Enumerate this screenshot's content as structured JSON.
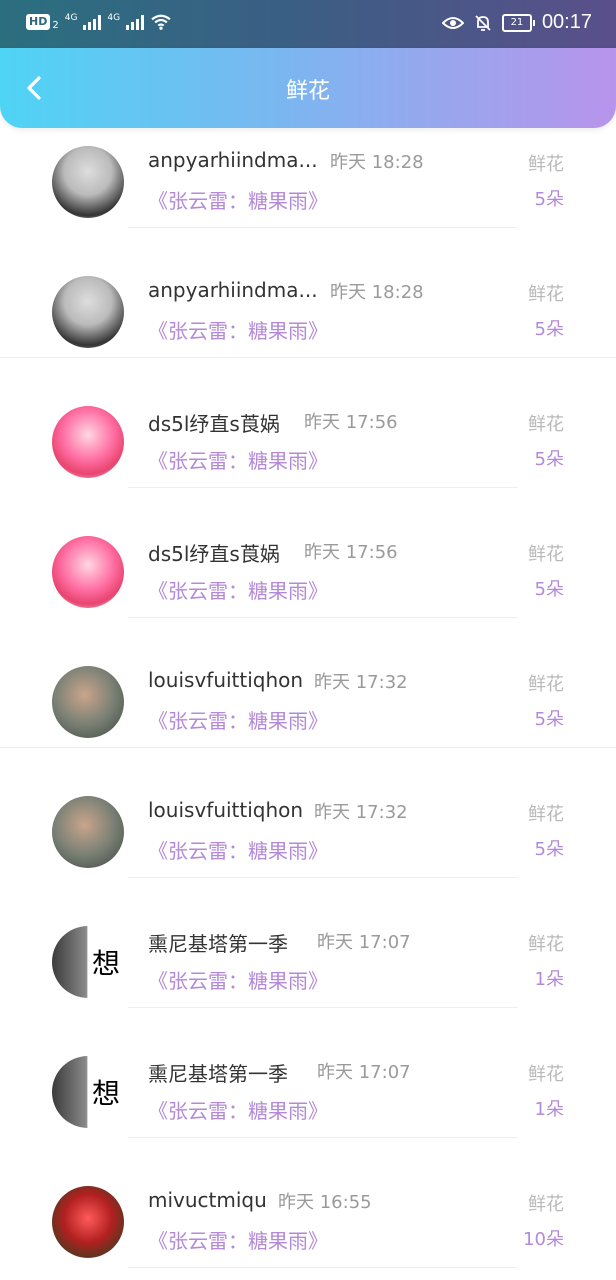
{
  "status_bar": {
    "hd_label": "HD",
    "hd_sub": "2",
    "net1": "4G",
    "net2": "4G",
    "battery": "21",
    "time": "00:17"
  },
  "header": {
    "title": "鲜花"
  },
  "records": [
    {
      "name": "anpyarhiindma...",
      "time": "昨天 18:28",
      "work": "《张云雷：糖果雨》",
      "gift_label": "鲜花",
      "gift_count": "5朵",
      "avatar": "police"
    },
    {
      "name": "anpyarhiindma...",
      "time": "昨天 18:28",
      "work": "《张云雷：糖果雨》",
      "gift_label": "鲜花",
      "gift_count": "5朵",
      "avatar": "police"
    },
    {
      "name": "ds5l纾直s莨娲",
      "time": "昨天 17:56",
      "work": "《张云雷：糖果雨》",
      "gift_label": "鲜花",
      "gift_count": "5朵",
      "avatar": "anime"
    },
    {
      "name": "ds5l纾直s莨娲",
      "time": "昨天 17:56",
      "work": "《张云雷：糖果雨》",
      "gift_label": "鲜花",
      "gift_count": "5朵",
      "avatar": "anime"
    },
    {
      "name": "louisvfuittiqhon",
      "time": "昨天 17:32",
      "work": "《张云雷：糖果雨》",
      "gift_label": "鲜花",
      "gift_count": "5朵",
      "avatar": "photo"
    },
    {
      "name": "louisvfuittiqhon",
      "time": "昨天 17:32",
      "work": "《张云雷：糖果雨》",
      "gift_label": "鲜花",
      "gift_count": "5朵",
      "avatar": "photo"
    },
    {
      "name": "熏尼基塔第一季",
      "time": "昨天 17:07",
      "work": "《张云雷：糖果雨》",
      "gift_label": "鲜花",
      "gift_count": "1朵",
      "avatar": "think",
      "avatar_text": "想"
    },
    {
      "name": "熏尼基塔第一季",
      "time": "昨天 17:07",
      "work": "《张云雷：糖果雨》",
      "gift_label": "鲜花",
      "gift_count": "1朵",
      "avatar": "think",
      "avatar_text": "想"
    },
    {
      "name": "mivuctmiqu",
      "time": "昨天 16:55",
      "work": "《张云雷：糖果雨》",
      "gift_label": "鲜花",
      "gift_count": "10朵",
      "avatar": "rose"
    }
  ],
  "colors": {
    "accent": "#b48ad8",
    "header_start": "#4fd4f5",
    "header_end": "#b894ec"
  }
}
